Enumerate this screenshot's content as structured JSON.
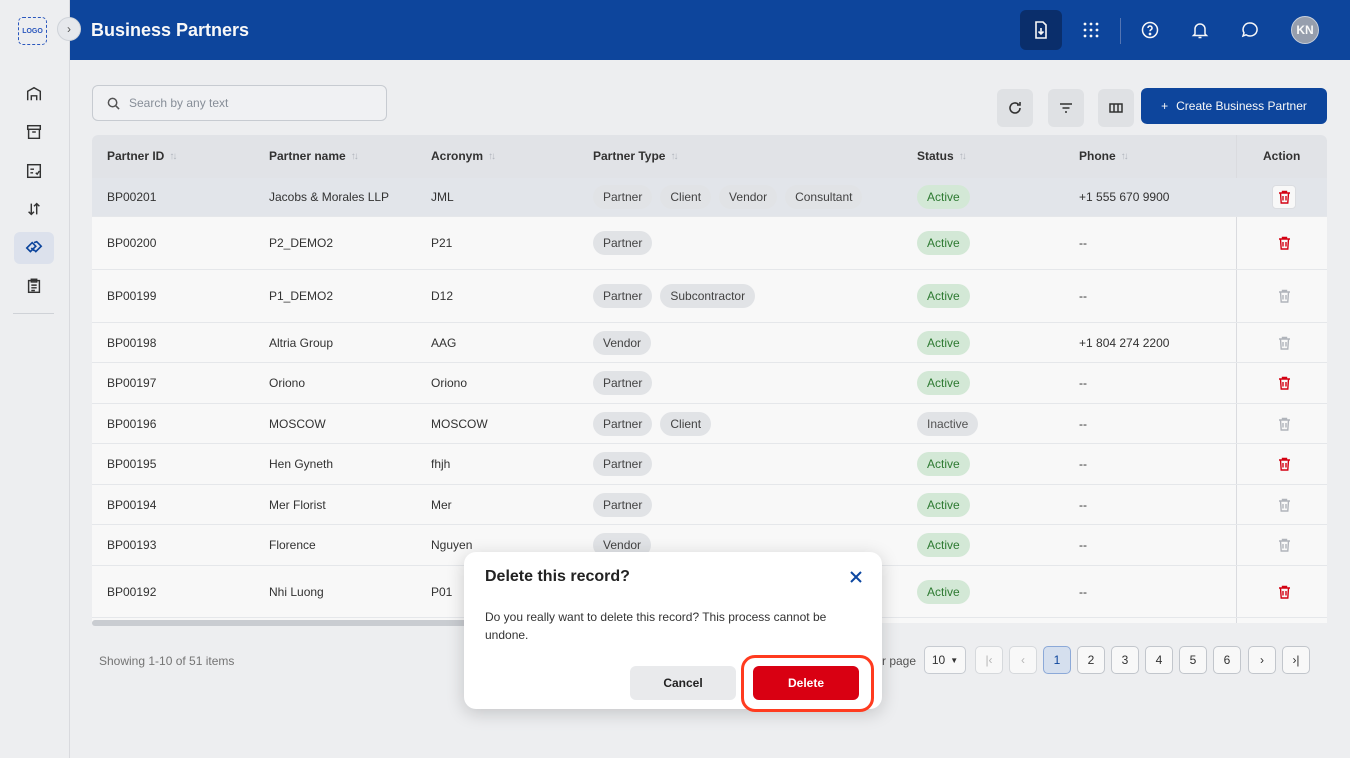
{
  "brand": {
    "logo_text": "LOGO"
  },
  "header": {
    "title": "Business Partners",
    "avatar_initials": "KN"
  },
  "search": {
    "placeholder": "Search by any text"
  },
  "toolbar": {
    "create_label": "Create Business Partner"
  },
  "table": {
    "columns": [
      "Partner ID",
      "Partner name",
      "Acronym",
      "Partner Type",
      "Status",
      "Phone",
      "Action"
    ],
    "rows": [
      {
        "id": "BP00201",
        "name": "Jacobs & Morales LLP",
        "acronym": "JML",
        "types": [
          "Partner",
          "Client",
          "Vendor",
          "Consultant"
        ],
        "status": "Active",
        "phone": "+1 555 670 9900"
      },
      {
        "id": "BP00200",
        "name": "P2_DEMO2",
        "acronym": "P21",
        "types": [
          "Partner"
        ],
        "status": "Active",
        "phone": "--"
      },
      {
        "id": "BP00199",
        "name": "P1_DEMO2",
        "acronym": "D12",
        "types": [
          "Partner",
          "Subcontractor"
        ],
        "status": "Active",
        "phone": "--"
      },
      {
        "id": "BP00198",
        "name": "Altria Group",
        "acronym": "AAG",
        "types": [
          "Vendor"
        ],
        "status": "Active",
        "phone": "+1 804 274 2200"
      },
      {
        "id": "BP00197",
        "name": "Oriono",
        "acronym": "Oriono",
        "types": [
          "Partner"
        ],
        "status": "Active",
        "phone": "--"
      },
      {
        "id": "BP00196",
        "name": "MOSCOW",
        "acronym": "MOSCOW",
        "types": [
          "Partner",
          "Client"
        ],
        "status": "Inactive",
        "phone": "--"
      },
      {
        "id": "BP00195",
        "name": "Hen Gyneth",
        "acronym": "fhjh",
        "types": [
          "Partner"
        ],
        "status": "Active",
        "phone": "--"
      },
      {
        "id": "BP00194",
        "name": "Mer Florist",
        "acronym": "Mer",
        "types": [
          "Partner"
        ],
        "status": "Active",
        "phone": "--"
      },
      {
        "id": "BP00193",
        "name": "Florence",
        "acronym": "Nguyen",
        "types": [
          "Vendor"
        ],
        "status": "Active",
        "phone": "--"
      },
      {
        "id": "BP00192",
        "name": "Nhi Luong",
        "acronym": "P01",
        "types": [],
        "status": "Active",
        "phone": "--"
      }
    ]
  },
  "footer": {
    "showing": "Showing 1-10 of 51 items",
    "per_page_label": "r page",
    "per_page_value": "10",
    "pages": [
      "1",
      "2",
      "3",
      "4",
      "5",
      "6"
    ],
    "current_page": "1"
  },
  "dialog": {
    "title": "Delete this record?",
    "message": "Do you really want to delete this record? This process cannot be undone.",
    "cancel_label": "Cancel",
    "delete_label": "Delete"
  },
  "colors": {
    "brand": "#0d47a1",
    "danger": "#d90012",
    "active_bg": "#d9efdc",
    "active_text": "#2e7d32"
  }
}
